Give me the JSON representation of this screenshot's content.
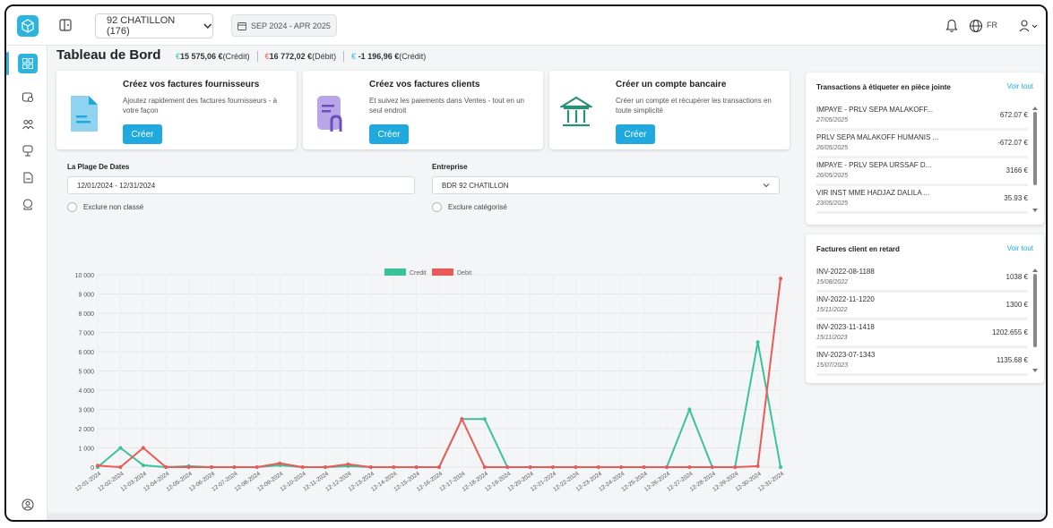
{
  "topbar": {
    "company": "92 CHATILLON (176)",
    "period": "SEP 2024 - APR 2025",
    "language": "FR"
  },
  "page": {
    "title": "Tableau de Bord",
    "credit_summary": "15 575,06 €",
    "credit_label": "(Crédit)",
    "debit_summary": "16 772,02 €",
    "debit_label": "(Débit)",
    "balance_summary": "-1 196,96 €",
    "balance_label": "(Crédit)"
  },
  "cards": [
    {
      "title": "Créez vos factures fournisseurs",
      "desc": "Ajoutez rapidement des factures fournisseurs - à votre façon",
      "button": "Créer",
      "icon": "supplier-invoice-icon"
    },
    {
      "title": "Créez vos factures clients",
      "desc": "Et suivez les paiements dans Ventes - tout en un seul endroit",
      "button": "Créer",
      "icon": "client-invoice-icon"
    },
    {
      "title": "Créer un compte bancaire",
      "desc": "Créer un compte et récupérer les transactions en toute simplicité",
      "button": "Créer",
      "icon": "bank-icon"
    }
  ],
  "filters": {
    "date_label": "La Plage De Dates",
    "date_value": "12/01/2024 - 12/31/2024",
    "company_label": "Entreprise",
    "company_value": "BDR 92 CHATILLON",
    "exclude_unclassified": "Exclure non classé",
    "exclude_categorized": "Exclure catégorisé"
  },
  "transactions_panel": {
    "title": "Transactions à étiqueter en pièce jointe",
    "link": "Voir tout",
    "rows": [
      {
        "label": "IMPAYE - PRLV SEPA MALAKOFF...",
        "date": "27/05/2025",
        "amount": "672.07 €"
      },
      {
        "label": "PRLV SEPA MALAKOFF HUMANIS ...",
        "date": "26/05/2025",
        "amount": "-672.07 €"
      },
      {
        "label": "IMPAYE - PRLV SEPA URSSAF D...",
        "date": "26/05/2025",
        "amount": "3166 €"
      },
      {
        "label": "VIR INST MME HADJAZ DALILA ...",
        "date": "23/05/2025",
        "amount": "35.93 €"
      }
    ]
  },
  "invoices_panel": {
    "title": "Factures client en retard",
    "link": "Voir tout",
    "rows": [
      {
        "label": "INV-2022-08-1188",
        "date": "15/08/2022",
        "amount": "1038 €"
      },
      {
        "label": "INV-2022-11-1220",
        "date": "15/11/2022",
        "amount": "1300 €"
      },
      {
        "label": "INV-2023-11-1418",
        "date": "15/11/2023",
        "amount": "1202.655 €"
      },
      {
        "label": "INV-2023-07-1343",
        "date": "15/07/2023",
        "amount": "1135.68 €"
      }
    ]
  },
  "colors": {
    "accent": "#2ab4df",
    "credit": "#3cc29a",
    "debit": "#ea5a5a"
  },
  "chart_data": {
    "type": "line",
    "title": "",
    "xlabel": "",
    "ylabel": "",
    "ylim": [
      0,
      10000
    ],
    "yticks": [
      "0",
      "1 000",
      "2 000",
      "3 000",
      "4 000",
      "5 000",
      "6 000",
      "7 000",
      "8 000",
      "9 000",
      "10 000"
    ],
    "legend_position": "top-center",
    "grid": true,
    "categories": [
      "12-01-2024",
      "12-02-2024",
      "12-03-2024",
      "12-04-2024",
      "12-05-2024",
      "12-06-2024",
      "12-07-2024",
      "12-08-2024",
      "12-09-2024",
      "12-10-2024",
      "12-11-2024",
      "12-12-2024",
      "12-13-2024",
      "12-14-2024",
      "12-15-2024",
      "12-16-2024",
      "12-17-2024",
      "12-18-2024",
      "12-19-2024",
      "12-20-2024",
      "12-21-2024",
      "12-22-2024",
      "12-23-2024",
      "12-24-2024",
      "12-25-2024",
      "12-26-2024",
      "12-27-2024",
      "12-28-2024",
      "12-29-2024",
      "12-30-2024",
      "12-31-2024"
    ],
    "series": [
      {
        "name": "Credit",
        "color": "#3cc29a",
        "values": [
          0,
          1000,
          100,
          0,
          50,
          0,
          0,
          0,
          100,
          0,
          0,
          50,
          0,
          0,
          0,
          0,
          2500,
          2500,
          0,
          0,
          0,
          0,
          0,
          0,
          0,
          0,
          3000,
          0,
          0,
          6500,
          0
        ]
      },
      {
        "name": "Debit",
        "color": "#ea5a5a",
        "values": [
          80,
          0,
          1000,
          0,
          0,
          0,
          0,
          0,
          200,
          0,
          0,
          150,
          0,
          0,
          0,
          0,
          2500,
          0,
          0,
          0,
          0,
          0,
          0,
          0,
          0,
          0,
          0,
          0,
          0,
          50,
          9800
        ]
      }
    ]
  }
}
